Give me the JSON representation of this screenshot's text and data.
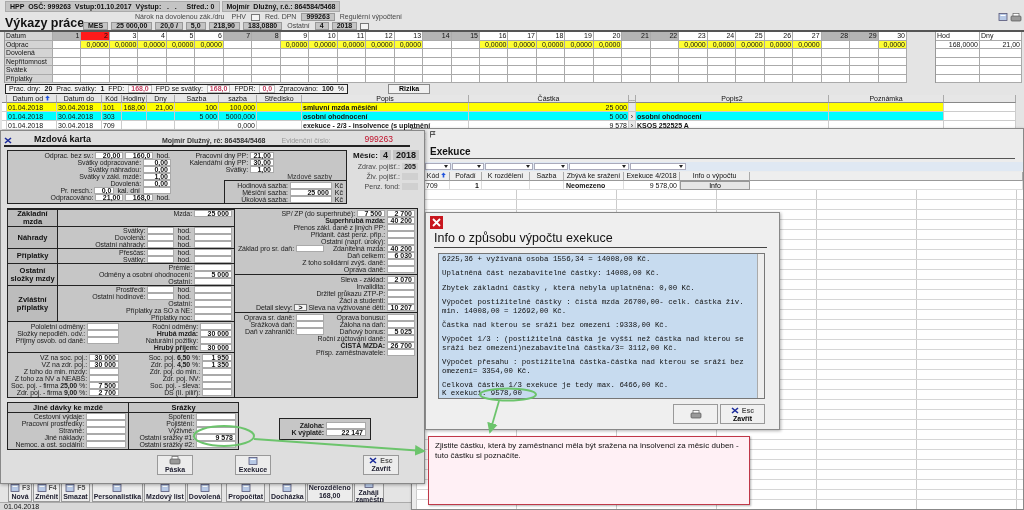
{
  "header": {
    "info": "HPP  OSČ: 999263  Vstup:01.10.2017  Výstup:   .   .     Střed.: 0",
    "employee": "Mojmír  Dlužný, r.č.: 864584/5468"
  },
  "title": "Výkazy práce",
  "meta_lines": [
    [
      {
        "kind": "caption",
        "text": "Nárok na dovolenou zák./dru"
      },
      {
        "kind": "caption",
        "text": "PHV"
      },
      {
        "kind": "button"
      },
      {
        "kind": "caption",
        "text": "Red. DPN"
      },
      {
        "kind": "field",
        "text": "999263"
      },
      {
        "kind": "caption",
        "text": "Regulérní výpočtení"
      }
    ],
    [
      {
        "kind": "field",
        "text": "MES"
      },
      {
        "kind": "field",
        "text": "25 000,00"
      },
      {
        "kind": "field",
        "text": "20,0 /"
      },
      {
        "kind": "field",
        "text": "5,0"
      },
      {
        "kind": "field",
        "text": "218,90"
      },
      {
        "kind": "field",
        "text": "183,0880"
      },
      {
        "kind": "caption",
        "text": "Ostatní"
      },
      {
        "kind": "field",
        "text": "4"
      },
      {
        "kind": "field",
        "text": "2018"
      },
      {
        "kind": "button"
      }
    ]
  ],
  "time_grid": {
    "row_labels": [
      "Datum",
      "Odprac",
      "Dovolená",
      "Nepřítomnost",
      "Svátek",
      "Příplatky"
    ],
    "days": [
      {
        "day": "1",
        "weekend": true,
        "selected": false
      },
      {
        "day": "2",
        "weekend": false,
        "selected": true,
        "worked": "0,0000"
      },
      {
        "day": "3",
        "weekend": false,
        "selected": false,
        "worked": "0,0000"
      },
      {
        "day": "4",
        "weekend": false,
        "selected": false,
        "worked": "0,0000"
      },
      {
        "day": "5",
        "weekend": false,
        "selected": false,
        "worked": "0,0000"
      },
      {
        "day": "6",
        "weekend": false,
        "selected": false,
        "worked": "0,0000"
      },
      {
        "day": "7",
        "weekend": true,
        "selected": false
      },
      {
        "day": "8",
        "weekend": true,
        "selected": false
      },
      {
        "day": "9",
        "weekend": false,
        "selected": false,
        "worked": "0,0000"
      },
      {
        "day": "10",
        "weekend": false,
        "selected": false,
        "worked": "0,0000"
      },
      {
        "day": "11",
        "weekend": false,
        "selected": false,
        "worked": "0,0000"
      },
      {
        "day": "12",
        "weekend": false,
        "selected": false,
        "worked": "0,0000"
      },
      {
        "day": "13",
        "weekend": false,
        "selected": false,
        "worked": "0,0000"
      },
      {
        "day": "14",
        "weekend": true,
        "selected": false
      },
      {
        "day": "15",
        "weekend": true,
        "selected": false
      },
      {
        "day": "16",
        "weekend": false,
        "selected": false,
        "worked": "0,0000"
      },
      {
        "day": "17",
        "weekend": false,
        "selected": false,
        "worked": "0,0000"
      },
      {
        "day": "18",
        "weekend": false,
        "selected": false,
        "worked": "0,0000"
      },
      {
        "day": "19",
        "weekend": false,
        "selected": false,
        "worked": "0,0000"
      },
      {
        "day": "20",
        "weekend": false,
        "selected": false,
        "worked": "0,0000"
      },
      {
        "day": "21",
        "weekend": true,
        "selected": false
      },
      {
        "day": "22",
        "weekend": true,
        "selected": false
      },
      {
        "day": "23",
        "weekend": false,
        "selected": false,
        "worked": "0,0000"
      },
      {
        "day": "24",
        "weekend": false,
        "selected": false,
        "worked": "0,0000"
      },
      {
        "day": "25",
        "weekend": false,
        "selected": false,
        "worked": "0,0000"
      },
      {
        "day": "26",
        "weekend": false,
        "selected": false,
        "worked": "0,0000"
      },
      {
        "day": "27",
        "weekend": false,
        "selected": false,
        "worked": "0,0000"
      },
      {
        "day": "28",
        "weekend": true,
        "selected": false
      },
      {
        "day": "29",
        "weekend": true,
        "selected": false
      },
      {
        "day": "30",
        "weekend": false,
        "selected": false,
        "worked": "0,0000"
      }
    ],
    "totals": {
      "columns": [
        "Hod",
        "Dny"
      ],
      "values": [
        "168,0000",
        "21,00"
      ]
    }
  },
  "summary": {
    "items": [
      {
        "label": "Prac. dny:",
        "value": "20",
        "kind": "count"
      },
      {
        "label": "Prac. svátky:",
        "value": "1",
        "kind": "count"
      },
      {
        "label": "FPD:",
        "value": "168,0",
        "kind": "hours"
      },
      {
        "label": "FPD se svátky:",
        "value": "168,0",
        "kind": "hours"
      },
      {
        "label": "FPDR:",
        "value": "0,0",
        "kind": "hours"
      },
      {
        "label": "Zpracováno:",
        "value": "100",
        "kind": "count",
        "unit": "%"
      }
    ],
    "button": "Rizika"
  },
  "items": {
    "columns": [
      {
        "label": "Datum od",
        "sorted": true
      },
      {
        "label": "Datum do",
        "sorted": false
      },
      {
        "label": "Kód",
        "sorted": false
      },
      {
        "label": "Hodiny",
        "sorted": false
      },
      {
        "label": "Dny",
        "sorted": false
      },
      {
        "label": "Sazba",
        "sorted": false
      },
      {
        "label": "sazba",
        "sorted": false
      },
      {
        "label": "Středisko",
        "sorted": false
      },
      {
        "label": "Popis",
        "sorted": false
      },
      {
        "label": "Částka",
        "sorted": false
      },
      {
        "label": "...",
        "sorted": false
      },
      {
        "label": "Popis2",
        "sorted": false
      },
      {
        "label": "Poznámka",
        "sorted": false
      }
    ],
    "rows": [
      {
        "color": "#ffff00",
        "date_from": "01.04.2018",
        "date_to": "30.04.2018",
        "code": "101",
        "hours": "168,00",
        "days": "21,00",
        "rate": "100",
        "rate2": "100,000",
        "description": "smluvní mzda měsíční",
        "amount": "25 000"
      },
      {
        "color": "#00ffff",
        "date_from": "01.04.2018",
        "date_to": "30.04.2018",
        "code": "303",
        "rate": "5 000",
        "rate2": "5000,000",
        "description": "osobní ohodnocení",
        "amount": "5 000",
        "marker": "›",
        "description2": "osobní ohodnocení"
      },
      {
        "color": "#ffffff",
        "date_from": "01.04.2018",
        "date_to": "30.04.2018",
        "code": "709",
        "rate2": "0,000",
        "description": "exekuce - 2/3 - insolvence (s uplatnění",
        "amount": "9 578",
        "marker": "›",
        "description2": "KSOS 252525 A"
      }
    ]
  },
  "toolbar": [
    [
      {
        "kind": "icon",
        "label": "Nová",
        "key": "F3"
      },
      {
        "kind": "icon",
        "label": "Změnit",
        "key": "F4"
      },
      {
        "kind": "icon",
        "label": "Smazat",
        "key": "F5"
      }
    ],
    [
      {
        "kind": "icon",
        "label": "Personalistika"
      },
      {
        "kind": "icon",
        "label": "Mzdový list"
      },
      {
        "kind": "icon",
        "label": "Dovolená"
      }
    ],
    [
      {
        "kind": "icon",
        "label": "Propočítat"
      }
    ],
    [
      {
        "kind": "icon",
        "label": "Docházka"
      },
      {
        "kind": "counter",
        "label": "Nerozděleno",
        "value": "168,00"
      },
      {
        "kind": "icon",
        "label": "Zaháji zaměstn"
      }
    ]
  ],
  "status_bar": "01.04.2018",
  "salary_card": {
    "title": "Mzdová karta",
    "employee": "Mojmír  Dlužný, rč: 864584/5468",
    "evidence_label": "Evidenční číslo:",
    "evidence_number": "999263",
    "attendance": [
      {
        "label": "Odprac. bez sv.:",
        "cells": [
          {
            "kind": "field",
            "value": "20,00"
          },
          {
            "kind": "field",
            "value": "160,0"
          },
          {
            "kind": "unit",
            "text": "hod."
          }
        ]
      },
      {
        "label": "Svátky odpracované:",
        "cells": [
          {
            "kind": "field",
            "value": "0,00"
          }
        ]
      },
      {
        "label": "Svátky náhradou:",
        "cells": [
          {
            "kind": "field",
            "value": "0,00"
          }
        ]
      },
      {
        "label": "Svátky v zákl. mzdě:",
        "cells": [
          {
            "kind": "field",
            "value": "1,00"
          }
        ]
      },
      {
        "label": "Dovolená:",
        "cells": [
          {
            "kind": "field",
            "value": "0,00"
          }
        ]
      },
      {
        "label": "Pr. nesch.:",
        "cells": [
          {
            "kind": "field",
            "value": "0,0"
          },
          {
            "kind": "unit",
            "text": "kal. dní"
          },
          {
            "kind": "field"
          }
        ]
      },
      {
        "label": "Odpracováno:",
        "cells": [
          {
            "kind": "field",
            "value": "21,00"
          },
          {
            "kind": "field",
            "value": "168,0"
          },
          {
            "kind": "unit",
            "text": "hod."
          }
        ]
      }
    ],
    "days": [
      {
        "label": "Pracovní dny PP:",
        "cells": [
          {
            "kind": "field",
            "value": "21,00"
          }
        ]
      },
      {
        "label": "Kalendářní dny PP:",
        "cells": [
          {
            "kind": "field",
            "value": "30,00"
          }
        ]
      },
      {
        "label": "Svátky:",
        "cells": [
          {
            "kind": "field",
            "value": "1,00"
          }
        ]
      }
    ],
    "rates": {
      "title": "Mzdové sazby",
      "rows": [
        {
          "label": "Hodinová sazba:",
          "cells": [
            {
              "kind": "field"
            },
            {
              "kind": "unit",
              "text": "Kč"
            }
          ]
        },
        {
          "label": "Měsíční sazba:",
          "cells": [
            {
              "kind": "field",
              "value": "25 000"
            },
            {
              "kind": "unit",
              "text": "Kč"
            }
          ]
        },
        {
          "label": "Úkolová sazba:",
          "cells": [
            {
              "kind": "field"
            },
            {
              "kind": "unit",
              "text": "Kč"
            }
          ]
        }
      ]
    },
    "month": {
      "label": "Měsíc:",
      "month": "4",
      "year": "2018"
    },
    "insurance": [
      {
        "label": "Zdrav. pojišť.:",
        "value": "205"
      },
      {
        "label": "Živ. pojišť.:"
      },
      {
        "label": "Penz. fond:"
      }
    ],
    "groups": [
      {
        "title": "Základní mzda",
        "rows": [
          {
            "label": "Mzda:",
            "cells": [
              {
                "kind": "field",
                "value": "25 000"
              }
            ]
          }
        ]
      },
      {
        "title": "Náhrady",
        "rows": [
          {
            "label": "Svátky:",
            "cells": [
              {
                "kind": "field"
              },
              {
                "kind": "unit",
                "text": "hod."
              },
              {
                "kind": "field"
              }
            ]
          },
          {
            "label": "Dovolená:",
            "cells": [
              {
                "kind": "field"
              },
              {
                "kind": "unit",
                "text": "hod."
              },
              {
                "kind": "field"
              }
            ]
          },
          {
            "label": "Ostatní náhrady:",
            "cells": [
              {
                "kind": "field"
              },
              {
                "kind": "unit",
                "text": "hod."
              },
              {
                "kind": "field"
              }
            ]
          }
        ]
      },
      {
        "title": "Příplatky",
        "rows": [
          {
            "label": "Přesčas:",
            "cells": [
              {
                "kind": "field"
              },
              {
                "kind": "unit",
                "text": "hod."
              },
              {
                "kind": "field"
              }
            ]
          },
          {
            "label": "Svátky:",
            "cells": [
              {
                "kind": "field"
              },
              {
                "kind": "unit",
                "text": "hod."
              },
              {
                "kind": "field"
              }
            ]
          }
        ]
      },
      {
        "title": "Ostatní složky mzdy",
        "rows": [
          {
            "label": "Prémie:",
            "cells": [
              {
                "kind": "field"
              }
            ]
          },
          {
            "label": "Odměny a osobní ohodnocení:",
            "cells": [
              {
                "kind": "field",
                "value": "5 000"
              }
            ]
          },
          {
            "label": "Ostatní:",
            "cells": [
              {
                "kind": "field"
              }
            ]
          }
        ]
      },
      {
        "title": "Zvláštní příplatky",
        "rows": [
          {
            "label": "Prostředí:",
            "cells": [
              {
                "kind": "field"
              },
              {
                "kind": "unit",
                "text": "hod."
              },
              {
                "kind": "field"
              }
            ]
          },
          {
            "label": "Ostatní hodinové:",
            "cells": [
              {
                "kind": "field"
              },
              {
                "kind": "unit",
                "text": "hod."
              },
              {
                "kind": "field"
              }
            ]
          },
          {
            "label": "Ostatní:",
            "cells": [
              {
                "kind": "field"
              }
            ]
          },
          {
            "label": "Příplatky za SO a NE:",
            "cells": [
              {
                "kind": "field"
              }
            ]
          },
          {
            "label": "Příplatky noc:",
            "cells": [
              {
                "kind": "field"
              }
            ]
          }
        ]
      }
    ],
    "gross": [
      {
        "label": "Pololetní odměny:",
        "cells": [
          {
            "kind": "field"
          },
          {
            "kind": "label",
            "text": "Roční odměny:"
          },
          {
            "kind": "field"
          }
        ]
      },
      {
        "label": "Složky nepodléh. odv.:",
        "cells": [
          {
            "kind": "field"
          },
          {
            "kind": "label",
            "text": "Hrubá mzda:",
            "strong": true
          },
          {
            "kind": "field",
            "value": "30 000"
          }
        ]
      },
      {
        "label": "Příjmy osvob. od daně:",
        "cells": [
          {
            "kind": "field"
          },
          {
            "kind": "label",
            "text": "Naturální požitky:"
          },
          {
            "kind": "field"
          }
        ]
      },
      {
        "label": "Hrubý příjem:",
        "strong": true,
        "cells": [
          {
            "kind": "field",
            "value": "30 000"
          }
        ]
      }
    ],
    "contributions": [
      {
        "label": "VZ na soc. poj.:",
        "cells": [
          {
            "kind": "field",
            "value": "30 000"
          },
          {
            "kind": "label",
            "text": "Soc. poj. **6,50** %:"
          },
          {
            "kind": "field",
            "value": "1 950"
          }
        ]
      },
      {
        "label": "VZ na zdr. poj.:",
        "cells": [
          {
            "kind": "field",
            "value": "30 000"
          },
          {
            "kind": "label",
            "text": "Zdr. poj. **4,50** %:"
          },
          {
            "kind": "field",
            "value": "1 350"
          }
        ]
      },
      {
        "label": "Z toho do min. mzdy:",
        "cells": [
          {
            "kind": "field"
          },
          {
            "kind": "label",
            "text": "Zdr. poj. do min.:"
          },
          {
            "kind": "field"
          }
        ]
      },
      {
        "label": "Z toho za NV a NEABS:",
        "cells": [
          {
            "kind": "field"
          },
          {
            "kind": "label",
            "text": "Zdr. poj. NV:"
          },
          {
            "kind": "field"
          }
        ]
      },
      {
        "label": "Soc. poj. - firma **25,00** %:",
        "cells": [
          {
            "kind": "field",
            "value": "7 500"
          },
          {
            "kind": "label",
            "text": "Soc. poj. - sleva:"
          },
          {
            "kind": "field"
          }
        ]
      },
      {
        "label": "Zdr. poj. - firma **9,00** %:",
        "cells": [
          {
            "kind": "field",
            "value": "2 700"
          },
          {
            "kind": "label",
            "text": "DS (II. pilíř):"
          },
          {
            "kind": "field"
          }
        ]
      }
    ],
    "tax": [
      [
        {
          "label": "SP/ ZP (do superhrubé):",
          "cells": [
            {
              "kind": "field",
              "value": "7 500"
            },
            {
              "kind": "field",
              "value": "2 700"
            }
          ]
        },
        {
          "label": "Superhrubá mzda:",
          "strong": true,
          "cells": [
            {
              "kind": "field",
              "value": "40 200"
            }
          ]
        },
        {
          "label": "Přenos zákl. daně z jiných PP:",
          "cells": [
            {
              "kind": "field"
            }
          ]
        },
        {
          "label": "Přidanit. část penz. přip.:",
          "cells": [
            {
              "kind": "field"
            }
          ]
        },
        {
          "label": "Ostatní (např. úroky):",
          "cells": [
            {
              "kind": "field"
            }
          ]
        },
        {
          "label": "Základ pro sr. daň:",
          "cells": [
            {
              "kind": "field"
            },
            {
              "kind": "label",
              "text": "Zdanitelná mzda:"
            },
            {
              "kind": "field",
              "value": "40 200"
            }
          ]
        },
        {
          "label": "Daň celkem:",
          "cells": [
            {
              "kind": "field",
              "value": "6 030"
            }
          ]
        },
        {
          "label": "Z toho solidární zvýš. daně:",
          "cells": [
            {
              "kind": "field"
            }
          ]
        },
        {
          "label": "Oprava daně:",
          "cells": [
            {
              "kind": "field"
            }
          ]
        }
      ],
      [
        {
          "label": "Sleva - základ:",
          "cells": [
            {
              "kind": "field",
              "value": "2 070"
            }
          ]
        },
        {
          "label": "Invalidita:",
          "cells": [
            {
              "kind": "field"
            }
          ]
        },
        {
          "label": "Držitel průkazu ZTP-P:",
          "cells": [
            {
              "kind": "field"
            }
          ]
        },
        {
          "label": "Žáci a studenti:",
          "cells": [
            {
              "kind": "field"
            }
          ]
        },
        {
          "label": "Detail slevy:",
          "cells": [
            {
              "kind": "button",
              "text": ">"
            },
            {
              "kind": "label",
              "text": "Sleva na vyživované děti:"
            },
            {
              "kind": "field",
              "value": "10 207"
            }
          ]
        }
      ],
      [
        {
          "label": "Oprava sr. daně:",
          "cells": [
            {
              "kind": "field"
            },
            {
              "kind": "label",
              "text": "Oprava bonusu:"
            },
            {
              "kind": "field"
            }
          ]
        },
        {
          "label": "Srážková daň:",
          "cells": [
            {
              "kind": "field"
            },
            {
              "kind": "label",
              "text": "Záloha na daň:"
            },
            {
              "kind": "field"
            }
          ]
        },
        {
          "label": "Daň v zahraničí:",
          "cells": [
            {
              "kind": "field"
            },
            {
              "kind": "label",
              "text": "Daňový bonus:"
            },
            {
              "kind": "field",
              "value": "5 025"
            }
          ]
        },
        {
          "label": "Roční zúčtování daně:",
          "cells": [
            {
              "kind": "field"
            }
          ]
        },
        {
          "label": "ČISTÁ MZDA:",
          "strong": true,
          "cells": [
            {
              "kind": "field",
              "value": "26 700"
            }
          ]
        },
        {
          "label": "Přísp. zaměstnavatele:",
          "cells": [
            {
              "kind": "field"
            }
          ]
        }
      ]
    ],
    "benefits": {
      "title": "Jiné dávky ke mzdě",
      "rows": [
        {
          "label": "Cestovní výdaje:",
          "cells": [
            {
              "kind": "field"
            }
          ]
        },
        {
          "label": "Pracovní prostředky:",
          "cells": [
            {
              "kind": "field"
            }
          ]
        },
        {
          "label": "Stravné:",
          "cells": [
            {
              "kind": "field"
            }
          ]
        },
        {
          "label": "Jiné náklady:",
          "cells": [
            {
              "kind": "field"
            }
          ]
        },
        {
          "label": "Nemoc. a ost. sociální:",
          "cells": [
            {
              "kind": "field"
            }
          ]
        }
      ]
    },
    "deductions": {
      "title": "Srážky",
      "rows": [
        {
          "label": "Spoření:",
          "cells": [
            {
              "kind": "field"
            }
          ]
        },
        {
          "label": "Pojištění:",
          "cells": [
            {
              "kind": "field"
            }
          ]
        },
        {
          "label": "Výživné:",
          "cells": [
            {
              "kind": "field"
            }
          ]
        },
        {
          "label": "Ostatní srážky #1:",
          "cells": [
            {
              "kind": "field",
              "value": "9 578"
            }
          ]
        },
        {
          "label": "Ostatní srážky #2:",
          "cells": [
            {
              "kind": "field"
            }
          ]
        }
      ]
    },
    "payout": [
      {
        "label": "Záloha:",
        "strong": true,
        "cells": [
          {
            "kind": "field"
          }
        ]
      },
      {
        "label": "K výplatě:",
        "strong": true,
        "cells": [
          {
            "kind": "field",
            "value": "22 147"
          }
        ]
      }
    ],
    "buttons": [
      {
        "label": "Páska",
        "kind": "print"
      },
      {
        "label": "Exekuce",
        "kind": "execution"
      }
    ],
    "close_button": {
      "key": "Esc",
      "label": "Zavřít"
    }
  },
  "execution": {
    "title": "Exekuce",
    "columns": [
      {
        "label": "Kód",
        "sorted": true
      },
      {
        "label": "Pořadí",
        "sorted": false
      },
      {
        "label": "K rozdělení",
        "sorted": false
      },
      {
        "label": "Sazba",
        "sorted": false
      },
      {
        "label": "Zbývá ke sražení",
        "sorted": false
      },
      {
        "label": "Exekuce 4/2018",
        "sorted": false
      },
      {
        "label": "Info o výpočtu",
        "sorted": false
      }
    ],
    "rows": [
      {
        "code": "709",
        "order": "1",
        "remaining": "Neomezeno",
        "amount": "9 578,00",
        "info_button": "Info"
      }
    ]
  },
  "info_dialog": {
    "title": "Info o způsobu výpočtu exekuce",
    "paragraphs": [
      [
        "6225,36 + vyživaná osoba 1556,34 = 14008,00 Kč."
      ],
      [
        "Uplatněná část nezabavitelné částky: 14008,00 Kč."
      ],
      [
        "Zbytek základní částky , která nebyla uplatněna: 0,00 Kč."
      ],
      [
        "Výpočet postižitelné částky : čistá mzda 26700,00- celk. částka živ. min. 14008,00 = 12692,00 Kč."
      ],
      [
        "Částka nad kterou se sráží bez omezení :9338,00 Kč."
      ],
      [
        "Výpočet 1/3 : (postižitelná částka je vyšší než částka nad kterou se sráží bez omezení)nezabavitelná částka/3= 3112,00 Kč."
      ],
      [
        "Výpočet přesahu : postižitelná částka-částka nad kterou se sráží bez omezení= 3354,00 Kč."
      ],
      [
        "Celková částka 1/3 exekuce je tedy max. 6466,00 Kč.",
        "K exekuci: 9578,00"
      ]
    ],
    "close_button": {
      "key": "Esc",
      "label": "Zavřít"
    }
  },
  "callout": {
    "text": "Zjistite částku, která by zaměstnanci měla být sražena na insolvenci za měsíc duben - tuto částku si poznačíte."
  }
}
